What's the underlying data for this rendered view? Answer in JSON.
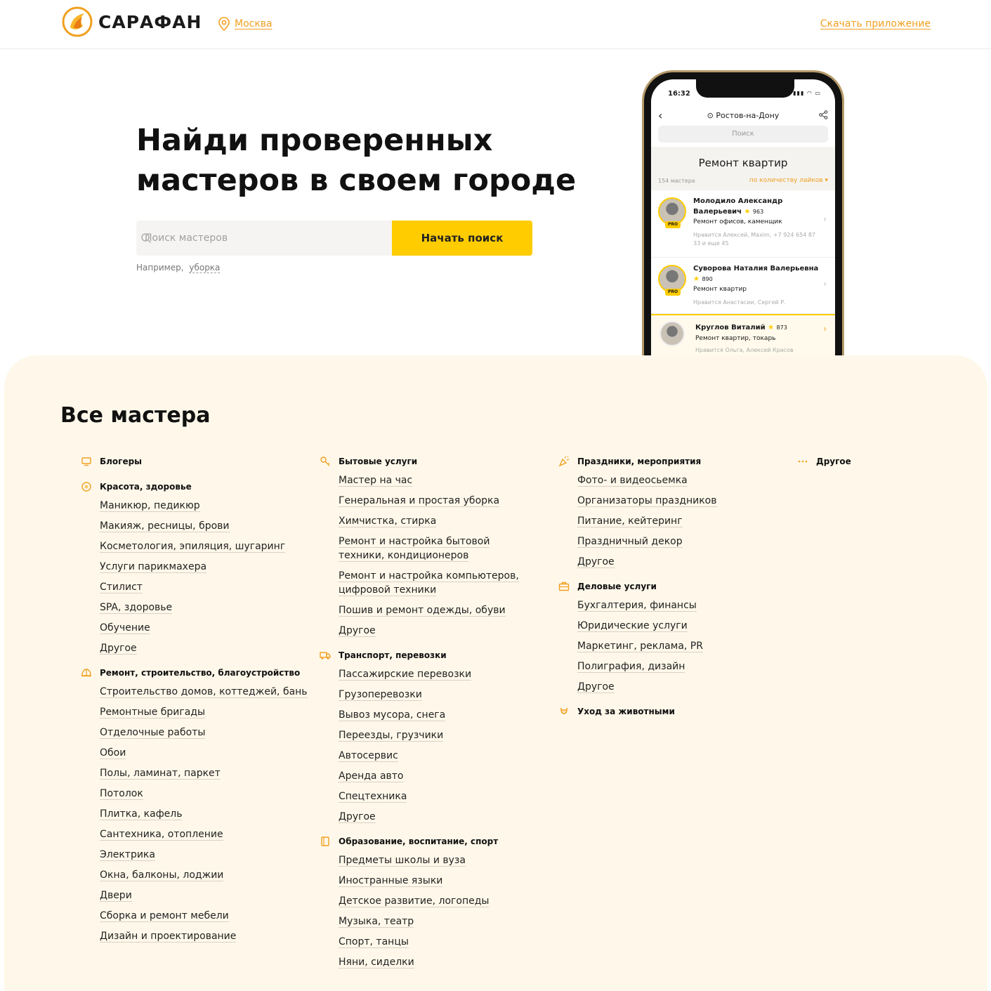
{
  "header": {
    "brand": "САРАФАН",
    "city": "Москва",
    "app_link": "Скачать приложение"
  },
  "hero": {
    "title_line1": "Найди проверенных",
    "title_line2": "мастеров в своем городе",
    "search_placeholder": "Поиск мастеров",
    "search_button": "Начать поиск",
    "example_label": "Например,",
    "example_value": "уборка"
  },
  "phone": {
    "time": "16:32",
    "city": "Ростов-на-Дону",
    "search": "Поиск",
    "heading": "Ремонт квартир",
    "count": "154 мастера",
    "sort": "по количеству лайков",
    "cards": [
      {
        "name": "Молодило Александр Валерьевич",
        "score": "963",
        "job": "Ремонт офисов, каменщик",
        "likes": "Нравится Алексей, Maxim, +7 924 654 87 33 и еще 45",
        "pro": "PRO"
      },
      {
        "name": "Суворова Наталия Валерьевна",
        "score": "890",
        "job": "Ремонт квартир",
        "likes": "Нравится Анастасии, Сергей Р.",
        "pro": "PRO"
      },
      {
        "name": "Круглов Виталий",
        "score": "873",
        "job": "Ремонт квартир, токарь",
        "likes": "Нравится Ольга, Алексей Красов"
      }
    ]
  },
  "catalog": {
    "title": "Все мастера",
    "col1": [
      {
        "title": "Блогеры",
        "icon": "monitor-icon",
        "items": []
      },
      {
        "title": "Красота, здоровье",
        "icon": "beauty-icon",
        "items": [
          "Маникюр, педикюр",
          "Макияж, ресницы, брови",
          "Косметология, эпиляция, шугаринг",
          "Услуги парикмахера",
          "Стилист",
          "SPA, здоровье",
          "Обучение",
          "Другое"
        ]
      },
      {
        "title": "Ремонт, строительство, благоустройство",
        "icon": "helmet-icon",
        "items": [
          "Строительство домов, коттеджей, бань",
          "Ремонтные бригады",
          "Отделочные работы",
          "Обои",
          "Полы, ламинат, паркет",
          "Потолок",
          "Плитка, кафель",
          "Сантехника, отопление",
          "Электрика",
          "Окна, балконы, лоджии",
          "Двери",
          "Сборка и ремонт мебели",
          "Дизайн и проектирование"
        ]
      }
    ],
    "col2": [
      {
        "title": "Бытовые услуги",
        "icon": "key-icon",
        "items": [
          "Мастер на час",
          "Генеральная и простая уборка",
          "Химчистка, стирка",
          "Ремонт и настройка бытовой техники, кондиционеров",
          "Ремонт и настройка компьютеров, цифровой техники",
          "Пошив и ремонт одежды, обуви",
          "Другое"
        ]
      },
      {
        "title": "Транспорт, перевозки",
        "icon": "truck-icon",
        "items": [
          "Пассажирские перевозки",
          "Грузоперевозки",
          "Вывоз мусора, снега",
          "Переезды, грузчики",
          "Автосервис",
          "Аренда авто",
          "Спецтехника",
          "Другое"
        ]
      },
      {
        "title": "Образование, воспитание, спорт",
        "icon": "book-icon",
        "items": [
          "Предметы школы и вуза",
          "Иностранные языки",
          "Детское развитие, логопеды",
          "Музыка, театр",
          "Спорт, танцы",
          "Няни, сиделки"
        ]
      }
    ],
    "col3": [
      {
        "title": "Праздники, мероприятия",
        "icon": "party-icon",
        "items": [
          "Фото- и видеосьемка",
          "Организаторы праздников",
          "Питание, кейтеринг",
          "Праздничный декор",
          "Другое"
        ]
      },
      {
        "title": "Деловые услуги",
        "icon": "briefcase-icon",
        "items": [
          "Бухгалтерия, финансы",
          "Юридические услуги",
          "Маркетинг, реклама, PR",
          "Полиграфия, дизайн",
          "Другое"
        ]
      },
      {
        "title": "Уход за животными",
        "icon": "dog-icon",
        "items": []
      }
    ],
    "col4": [
      {
        "title": "Другое",
        "icon": "dots-icon",
        "items": []
      }
    ]
  },
  "colors": {
    "accent": "#ffcc00",
    "link": "#f0a020",
    "catalog_bg": "#fff8ea"
  }
}
